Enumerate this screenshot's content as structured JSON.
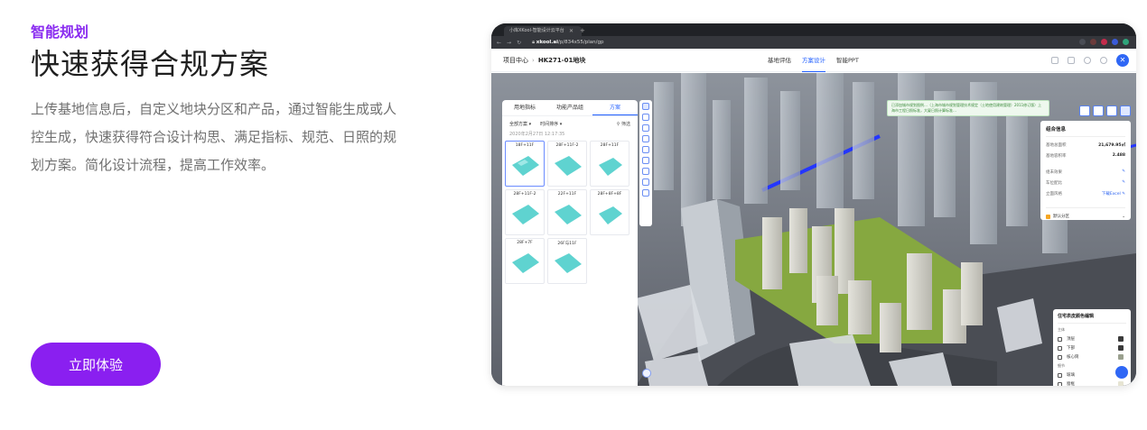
{
  "hero": {
    "eyebrow": "智能规划",
    "title": "快速获得合规方案",
    "description": "上传基地信息后，自定义地块分区和产品，通过智能生成或人控生成，快速获得符合设计构思、满足指标、规范、日照的规划方案。简化设计流程，提高工作效率。",
    "cta_label": "立即体验"
  },
  "browser": {
    "tab_title": "小库XKool-智能设计云平台",
    "url_domain": "xkool.ai",
    "url_path": "/p/834x55/plan/gp"
  },
  "app": {
    "breadcrumb_root": "项目中心",
    "breadcrumb_current": "HK271-01地块",
    "nav_tabs": [
      "基地评估",
      "方案设计",
      "智能PPT"
    ],
    "active_nav_tab": 1,
    "panel_tabs": [
      "用地指标",
      "功能产品组",
      "方案"
    ],
    "active_panel_tab": 2,
    "filter_all": "全部方案 ▾",
    "filter_sort": "时间排序 ▾",
    "filter_label": "筛选",
    "date": "2020年2月27日 12:17:35",
    "schemes": [
      "18F+11F",
      "28F+11F-2",
      "28F+11F",
      "28F+11F-2",
      "22F+11F",
      "28F+8F+8F",
      "28F+7F",
      "26F与11F"
    ],
    "selected_scheme": 0,
    "notice_text": "已添加城市规划图例…（上海市城市规划管理技术规定（土地使用建筑管理）2011修订版）上海市工程日照标准，大厦日照计算标准…",
    "info_title": "组合信息",
    "info_rows": [
      {
        "label": "基地总面积",
        "value": "21,679.95㎡"
      },
      {
        "label": "基地容积率",
        "value": "2.488"
      }
    ],
    "info_links": [
      {
        "label": "组未效果",
        "value": "✎"
      },
      {
        "label": "车位配比",
        "value": "✎"
      },
      {
        "label": "立面风格",
        "value": "下载Excel ✎"
      }
    ],
    "info_footer": "默认分区",
    "legend_title": "住宅表皮颜色编辑",
    "legend_sections": [
      "主体",
      "细节"
    ],
    "legend_items": [
      {
        "label": "顶层",
        "color": "#3a3a3a"
      },
      {
        "label": "下部",
        "color": "#3a3a3a"
      },
      {
        "label": "核心筒",
        "color": "#9aa08e"
      },
      {
        "label": "玻璃",
        "color": "#e6e4d2"
      },
      {
        "label": "窗框",
        "color": "#e6e4d2"
      }
    ]
  }
}
